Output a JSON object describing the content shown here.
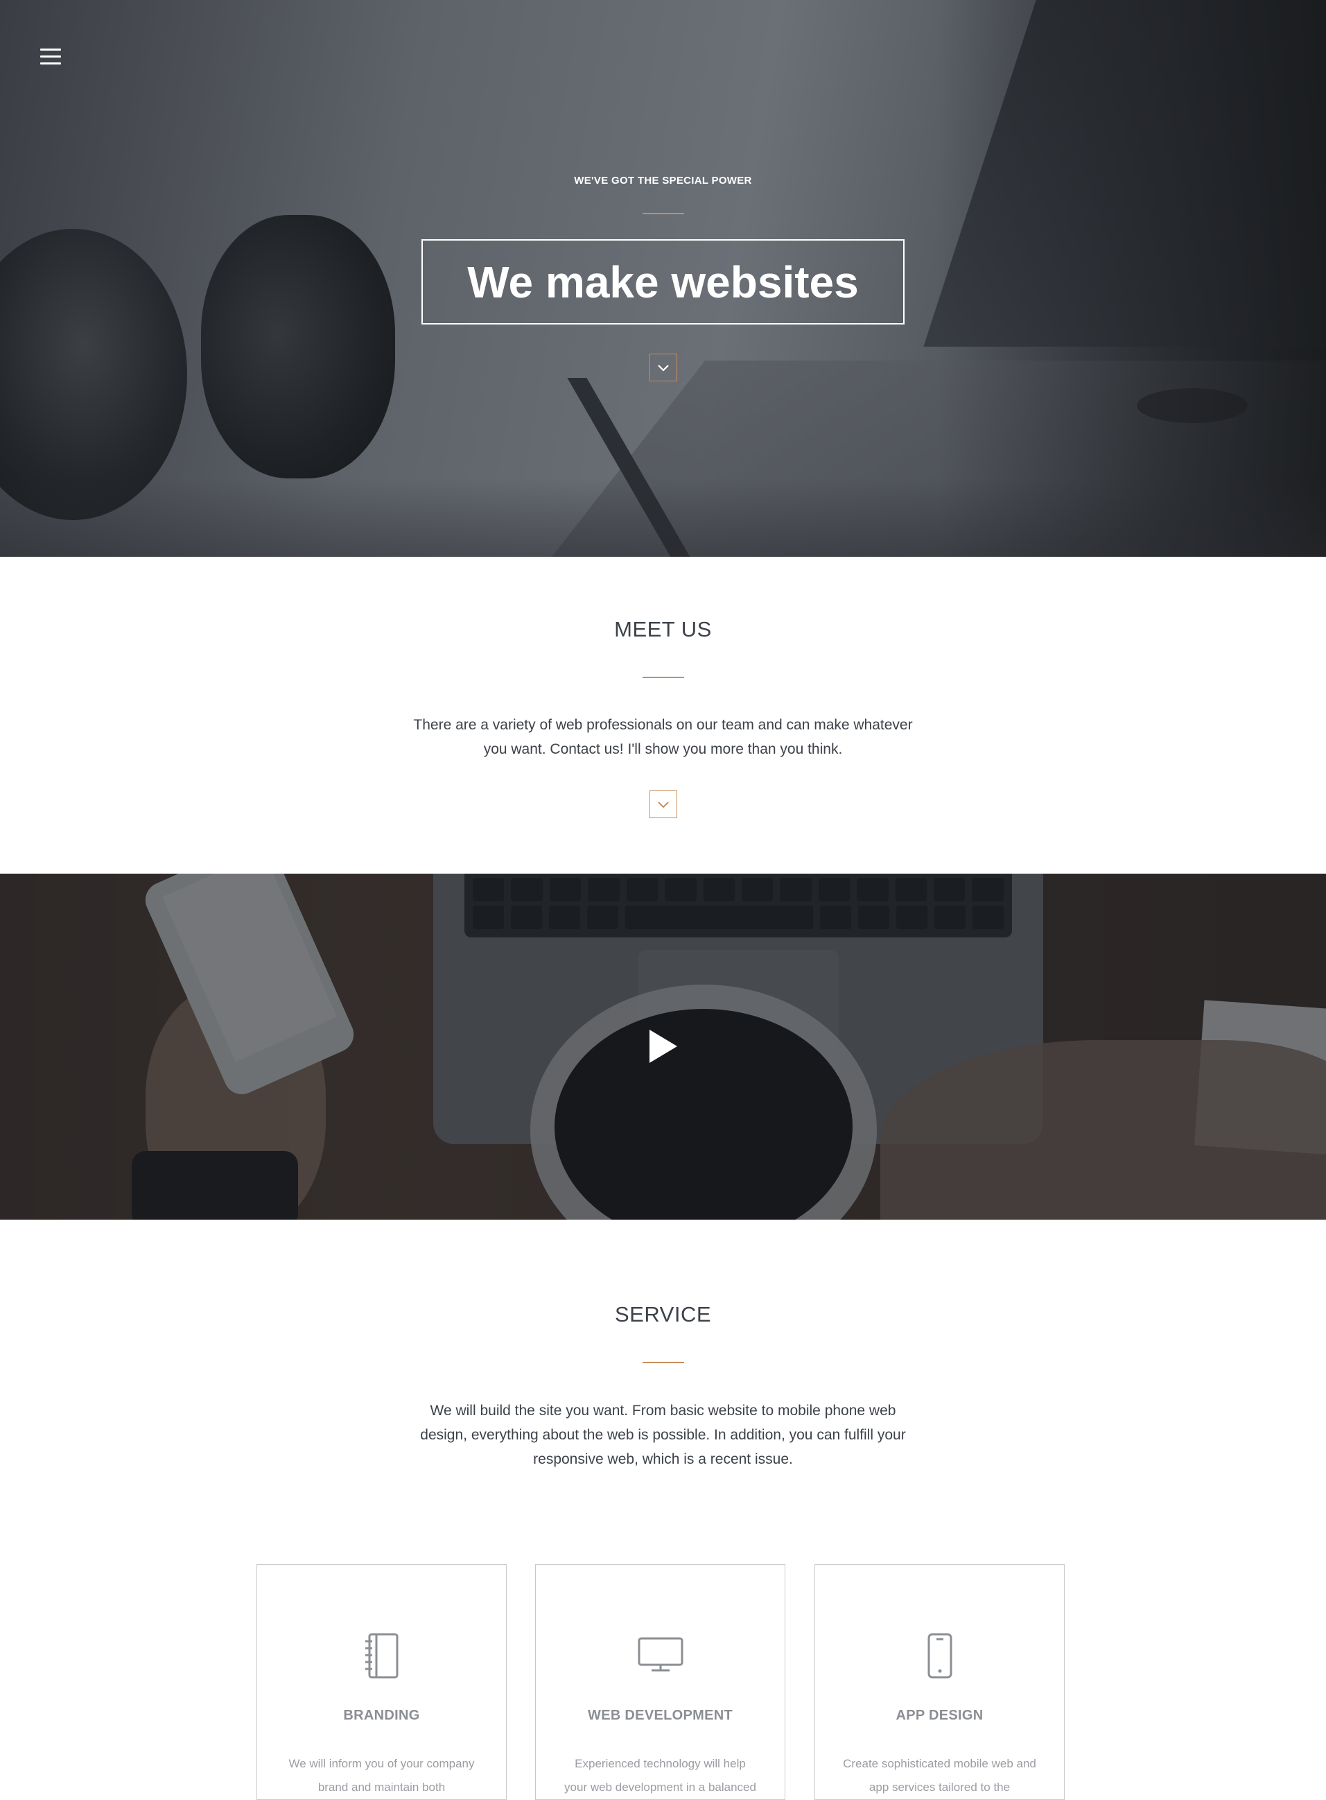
{
  "nav": {
    "menu_icon": "hamburger-menu-icon"
  },
  "hero": {
    "kicker": "WE'VE GOT THE SPECIAL POWER",
    "title": "We make websites",
    "scroll_icon": "chevron-down-icon"
  },
  "meet": {
    "title": "MEET US",
    "text": "There are a variety of web professionals on our team and can make whatever you want. Contact us! I'll show you more than you think.",
    "scroll_icon": "chevron-down-icon"
  },
  "video": {
    "play_icon": "play-icon"
  },
  "service": {
    "title": "SERVICE",
    "text": "We will build the site you want. From basic website to mobile phone web design, everything about the web is possible. In addition, you can fulfill your responsive web, which is a recent issue.",
    "cards": [
      {
        "icon": "notebook-icon",
        "title": "BRANDING",
        "text": "We will inform you of your company brand and maintain both"
      },
      {
        "icon": "monitor-icon",
        "title": "WEB DEVELOPMENT",
        "text": "Experienced technology will help your web development in a balanced"
      },
      {
        "icon": "smartphone-icon",
        "title": "APP DESIGN",
        "text": "Create sophisticated mobile web and app services tailored to the"
      }
    ]
  },
  "colors": {
    "accent": "#c98e5b",
    "text": "#3d4249",
    "card_border": "#c7c9cc",
    "card_text": "#9a9da2"
  }
}
